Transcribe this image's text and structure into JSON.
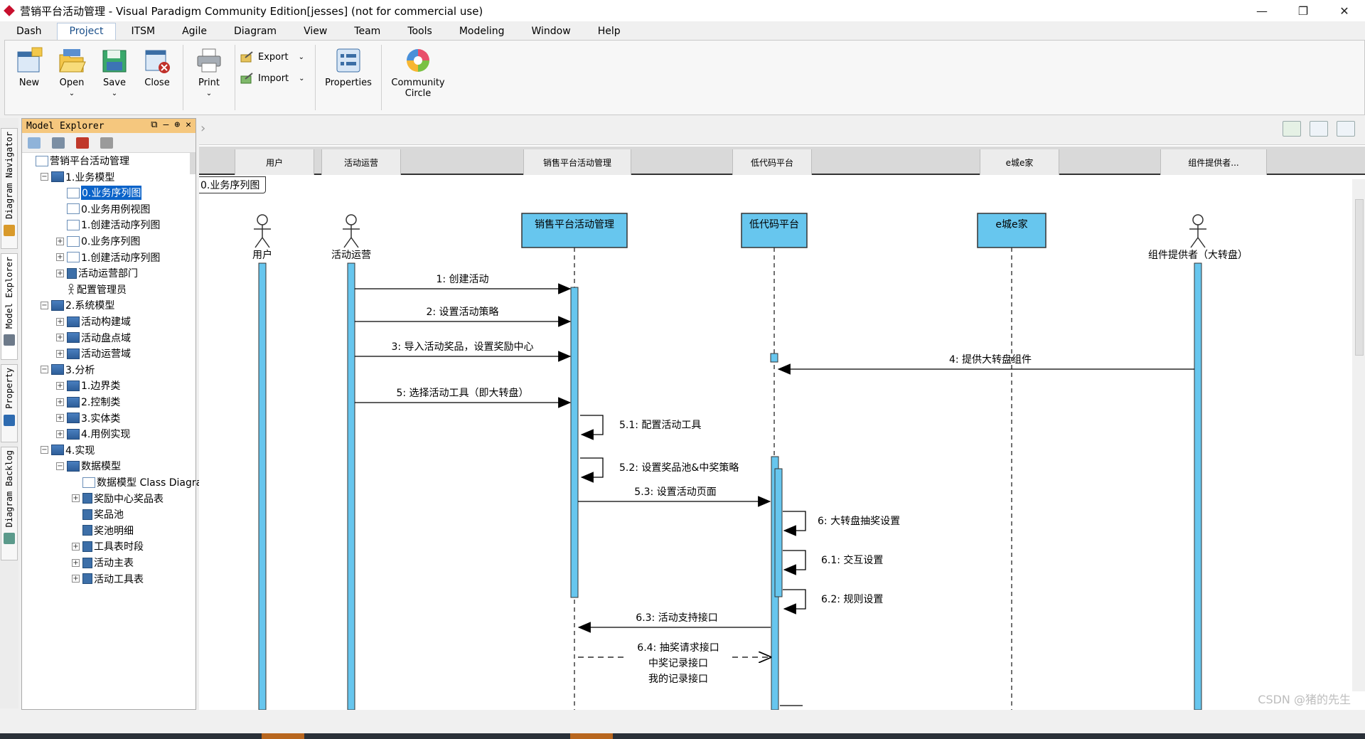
{
  "window": {
    "title": "营销平台活动管理 - Visual Paradigm Community Edition[jesses] (not for commercial use)",
    "minimize": "—",
    "maximize": "❐",
    "close": "✕"
  },
  "menu": [
    "Dash",
    "Project",
    "ITSM",
    "Agile",
    "Diagram",
    "View",
    "Team",
    "Tools",
    "Modeling",
    "Window",
    "Help"
  ],
  "ribbon": {
    "new": "New",
    "open": "Open",
    "save": "Save",
    "close": "Close",
    "print": "Print",
    "export": "Export",
    "import": "Import",
    "properties": "Properties",
    "community_line1": "Community",
    "community_line2": "Circle"
  },
  "side_tabs": [
    "Diagram Navigator",
    "Model Explorer",
    "Property",
    "Diagram Backlog"
  ],
  "explorer": {
    "title": "Model Explorer",
    "tree": [
      {
        "label": "营销平台活动管理",
        "icon": "project",
        "depth": 0,
        "toggle": ""
      },
      {
        "label": "1.业务模型",
        "icon": "pkg",
        "depth": 1,
        "toggle": "−"
      },
      {
        "label": "0.业务序列图",
        "icon": "diag",
        "depth": 2,
        "toggle": "",
        "selected": true
      },
      {
        "label": "0.业务用例视图",
        "icon": "diag",
        "depth": 2,
        "toggle": ""
      },
      {
        "label": "1.创建活动序列图",
        "icon": "diag",
        "depth": 2,
        "toggle": ""
      },
      {
        "label": "0.业务序列图",
        "icon": "diag",
        "depth": 2,
        "toggle": "+"
      },
      {
        "label": "1.创建活动序列图",
        "icon": "diag",
        "depth": 2,
        "toggle": "+"
      },
      {
        "label": "活动运营部门",
        "icon": "cls",
        "depth": 2,
        "toggle": "+"
      },
      {
        "label": "配置管理员",
        "icon": "actor",
        "depth": 2,
        "toggle": ""
      },
      {
        "label": "2.系统模型",
        "icon": "pkg",
        "depth": 1,
        "toggle": "−"
      },
      {
        "label": "活动构建域",
        "icon": "pkg",
        "depth": 2,
        "toggle": "+"
      },
      {
        "label": "活动盘点域",
        "icon": "pkg",
        "depth": 2,
        "toggle": "+"
      },
      {
        "label": "活动运营域",
        "icon": "pkg",
        "depth": 2,
        "toggle": "+"
      },
      {
        "label": "3.分析",
        "icon": "pkg",
        "depth": 1,
        "toggle": "−"
      },
      {
        "label": "1.边界类",
        "icon": "pkg",
        "depth": 2,
        "toggle": "+"
      },
      {
        "label": "2.控制类",
        "icon": "pkg",
        "depth": 2,
        "toggle": "+"
      },
      {
        "label": "3.实体类",
        "icon": "pkg",
        "depth": 2,
        "toggle": "+"
      },
      {
        "label": "4.用例实现",
        "icon": "pkg",
        "depth": 2,
        "toggle": "+"
      },
      {
        "label": "4.实现",
        "icon": "pkg",
        "depth": 1,
        "toggle": "−"
      },
      {
        "label": "数据模型",
        "icon": "pkg",
        "depth": 2,
        "toggle": "−"
      },
      {
        "label": "数据模型 Class Diagram",
        "icon": "diag",
        "depth": 3,
        "toggle": ""
      },
      {
        "label": "奖励中心奖品表",
        "icon": "cls",
        "depth": 3,
        "toggle": "+"
      },
      {
        "label": "奖品池",
        "icon": "cls",
        "depth": 3,
        "toggle": ""
      },
      {
        "label": "奖池明细",
        "icon": "cls",
        "depth": 3,
        "toggle": ""
      },
      {
        "label": "工具表时段",
        "icon": "cls",
        "depth": 3,
        "toggle": "+"
      },
      {
        "label": "活动主表",
        "icon": "cls",
        "depth": 3,
        "toggle": "+"
      },
      {
        "label": "活动工具表",
        "icon": "cls",
        "depth": 3,
        "toggle": "+"
      }
    ]
  },
  "diagram": {
    "name": "0.业务序列图",
    "lanes": [
      "用户",
      "活动运营",
      "销售平台活动管理",
      "低代码平台",
      "e城e家",
      "组件提供者..."
    ],
    "actors": {
      "user": "用户",
      "ops": "活动运营",
      "provider": "组件提供者（大转盘）"
    },
    "boxes": {
      "sales": "销售平台活动管理",
      "lowcode": "低代码平台",
      "ecity": "e城e家"
    },
    "messages": {
      "m1": "1: 创建活动",
      "m2": "2: 设置活动策略",
      "m3": "3: 导入活动奖品，设置奖励中心",
      "m4": "4: 提供大转盘组件",
      "m5": "5: 选择活动工具（即大转盘）",
      "m51": "5.1: 配置活动工具",
      "m52": "5.2: 设置奖品池&中奖策略",
      "m53": "5.3: 设置活动页面",
      "m6": "6: 大转盘抽奖设置",
      "m61": "6.1: 交互设置",
      "m62": "6.2: 规则设置",
      "m63": "6.3: 活动支持接口",
      "m64a": "6.4: 抽奖请求接口",
      "m64b": "中奖记录接口",
      "m64c": "我的记录接口"
    }
  },
  "colors": {
    "lifeline_box": "#67c6ee",
    "activation": "#67c6ee",
    "selection": "#0a63c9",
    "explorer_header": "#f5c77e"
  },
  "watermark": "CSDN @猪的先生"
}
